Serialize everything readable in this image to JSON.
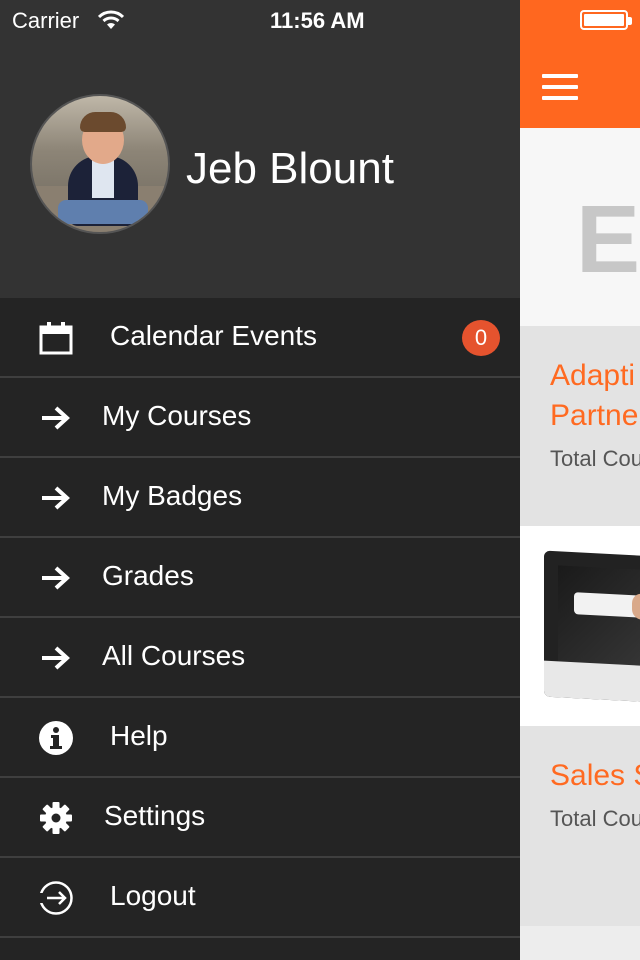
{
  "status_bar": {
    "carrier": "Carrier",
    "time": "11:56 AM"
  },
  "profile": {
    "name": "Jeb Blount"
  },
  "menu": {
    "items": [
      {
        "label": "Calendar Events",
        "icon": "calendar-icon",
        "badge": "0"
      },
      {
        "label": "My Courses",
        "icon": "arrow-right-icon"
      },
      {
        "label": "My Badges",
        "icon": "arrow-right-icon"
      },
      {
        "label": "Grades",
        "icon": "arrow-right-icon"
      },
      {
        "label": "All Courses",
        "icon": "arrow-right-icon"
      },
      {
        "label": "Help",
        "icon": "info-icon"
      },
      {
        "label": "Settings",
        "icon": "gear-icon"
      },
      {
        "label": "Logout",
        "icon": "logout-icon"
      }
    ]
  },
  "main": {
    "banner_logo": "EC",
    "cards": [
      {
        "title_line1": "Adapti",
        "title_line2": "Partne",
        "subtitle": "Total Cou"
      },
      {
        "title_line1": "Sales S",
        "subtitle": "Total Cou"
      }
    ]
  },
  "colors": {
    "accent": "#ff671f",
    "drawer_bg": "#242424",
    "profile_bg": "#333333",
    "badge": "#e5532e"
  }
}
